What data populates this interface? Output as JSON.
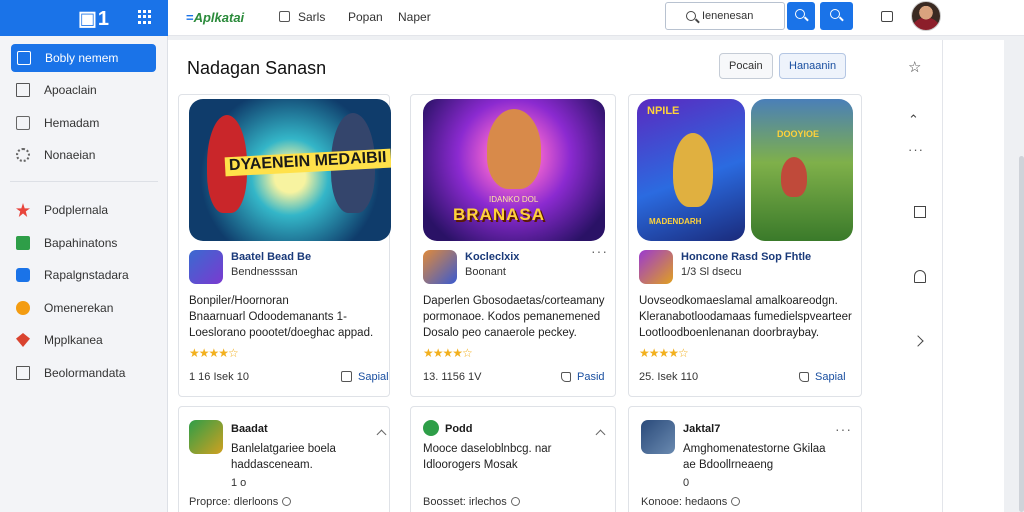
{
  "sidebar": {
    "items": [
      {
        "label": "Bobly nemem",
        "icon": "window-icon"
      },
      {
        "label": "Apoaclain",
        "icon": "frame-icon"
      },
      {
        "label": "Hemadam",
        "icon": "home-icon"
      },
      {
        "label": "Nonaeian",
        "icon": "gear-icon"
      },
      {
        "label": "Podplernala",
        "icon": "pin-icon"
      },
      {
        "label": "Bapahinatons",
        "icon": "green-app-icon"
      },
      {
        "label": "Rapalgnstadara",
        "icon": "blue-app-icon"
      },
      {
        "label": "Omenerekan",
        "icon": "orange-app-icon"
      },
      {
        "label": "Mpplkanea",
        "icon": "diamond-icon"
      },
      {
        "label": "Beolormandata",
        "icon": "frame-icon"
      }
    ]
  },
  "topbar": {
    "brand_prefix": "=",
    "brand": "Aplkatai",
    "nav": [
      "Sarls",
      "Popan",
      "Naper"
    ],
    "search_value": "Ienenesan"
  },
  "main": {
    "title": "Nadagan Sanasn",
    "buttons": [
      "Pocain",
      "Hanaanin"
    ],
    "cards": [
      {
        "hero_text": "DYAENEIN MEDAIBII",
        "app_name": "Baatel Bead Be",
        "app_sub": "Bendnesssan",
        "desc": [
          "Bonpiler/Hoornoran",
          "Bnaarnuarl Odoodemanants 1-",
          "Loeslorano poootet/doeghac appad."
        ],
        "stars": "★★★★☆",
        "meta": "1   16  Isek   10",
        "action": "Sapial"
      },
      {
        "hero_text": "BRANASA",
        "hero_sub": "IDANKO DOL",
        "app_name": "Kocleclxix",
        "app_sub": "Boonant",
        "desc": [
          "Daperlen Gbosodaetas/corteamany",
          "pormonaoe. Kodos pemanemened",
          "Dosalo peo canaerole peckey."
        ],
        "stars": "★★★★☆",
        "meta": "13. 1156   1V",
        "action": "Pasid"
      },
      {
        "hero_text": "NPILE",
        "hero_sub": "MADENDARH",
        "hero_text_b": "DOOYIOE",
        "app_name": "Honcone Rasd Sop Fhtle",
        "app_sub": "1/3 Sl dsecu",
        "desc": [
          "Uovseodkomaeslamal amalkoareodgn.",
          "Kleranabotloodamaas fumedielspvearteer",
          "Lootloodboenlenanan doorbraybay."
        ],
        "stars": "★★★★☆",
        "meta": "25.  Isek   110",
        "action": "Sapial"
      },
      {
        "app_name": "Baadat",
        "desc": [
          "Banlelatgariee boela",
          "haddasceneam."
        ],
        "meta": "1  o",
        "footer": "Proprce: dlerloons"
      },
      {
        "app_name": "Podd",
        "desc": [
          "Mooce daseloblnbcg. nar",
          "Idloorogers  Mosak"
        ],
        "footer": "Boosset:  irlechos"
      },
      {
        "app_name": "Jaktal7",
        "desc": [
          "Amghomenatestorne Gkilaa",
          "ae Bdoollrneaeng"
        ],
        "meta": "0",
        "footer": "Konooe: hedaons"
      }
    ]
  },
  "colors": {
    "accent": "#1a73e8",
    "star": "#f2b01e",
    "brand_green": "#2a8a3a"
  }
}
